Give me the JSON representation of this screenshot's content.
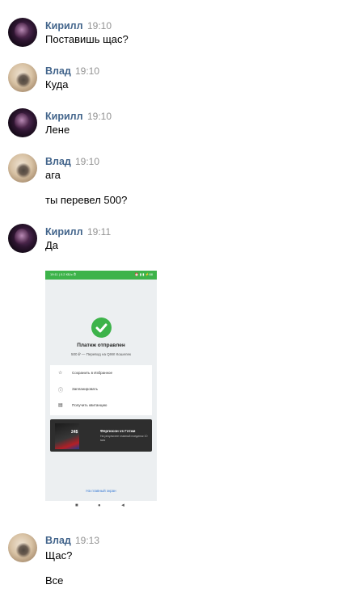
{
  "messages": [
    {
      "author": "Кирилл",
      "time": "19:10",
      "lines": [
        "Поставишь щас?"
      ]
    },
    {
      "author": "Влад",
      "time": "19:10",
      "lines": [
        "Куда"
      ]
    },
    {
      "author": "Кирилл",
      "time": "19:10",
      "lines": [
        "Лене"
      ]
    },
    {
      "author": "Влад",
      "time": "19:10",
      "lines": [
        "ага",
        "ты перевел 500?"
      ]
    },
    {
      "author": "Кирилл",
      "time": "19:11",
      "lines": [
        "Да"
      ]
    },
    {
      "author": "Влад",
      "time": "19:13",
      "lines": [
        "Щас?",
        "Все"
      ]
    }
  ],
  "attachment": {
    "status_left": "19:11 | 0.2 КБ/с ⏱",
    "status_right": "⏰ ▮ ▮ ⚡88",
    "title": "Платеж отправлен",
    "subtitle": "500 ₽ — Перевод на QIWI Кошелек",
    "actions": [
      {
        "icon": "☆",
        "label": "Сохранить в Избранное"
      },
      {
        "icon": "ⓘ",
        "label": "Запланировать"
      },
      {
        "icon": "▤",
        "label": "Получить квитанцию"
      }
    ],
    "promo": {
      "number": "24$",
      "title": "Фергюсон vs Гэтжи",
      "desc": "На результате главный поединок 10 мая"
    },
    "home_link": "На главный экран",
    "nav": [
      "■",
      "●",
      "◄"
    ]
  }
}
